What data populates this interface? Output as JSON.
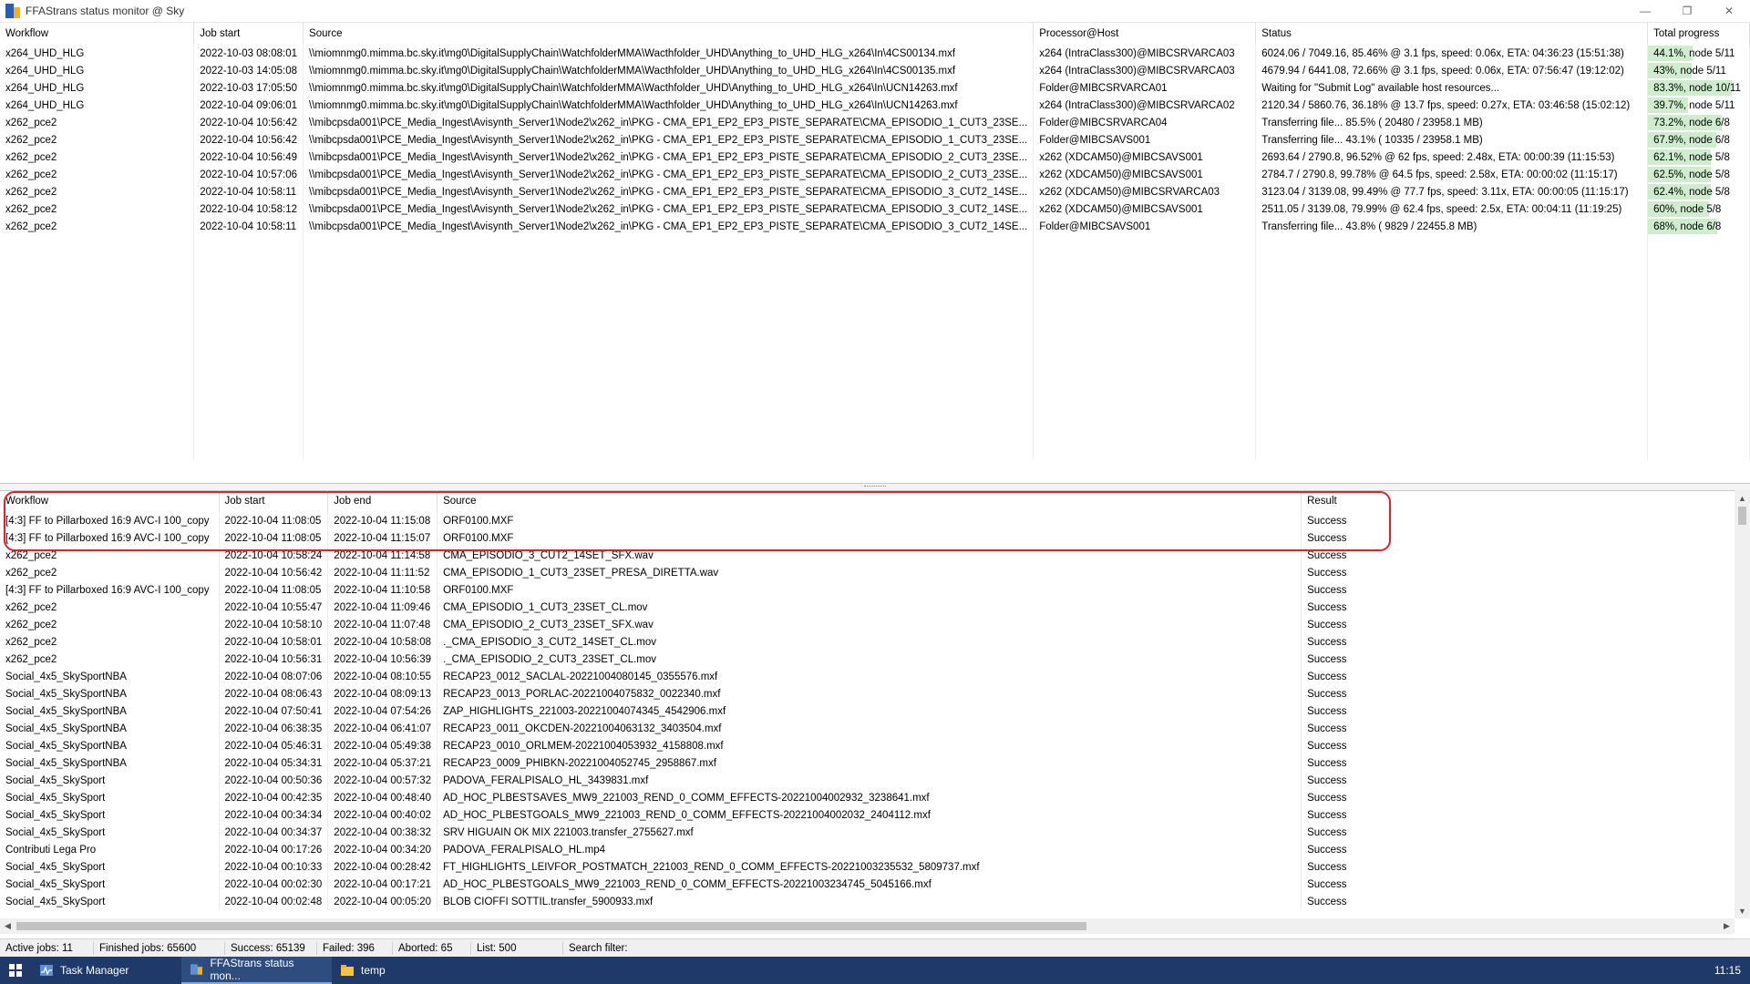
{
  "window": {
    "title": "FFAStrans status monitor @ Sky",
    "minimize": "—",
    "restore": "❐",
    "close": "✕"
  },
  "active_table": {
    "columns": [
      "Workflow",
      "Job start",
      "Source",
      "Processor@Host",
      "Status",
      "Total progress"
    ],
    "rows": [
      [
        "x264_UHD_HLG",
        "2022-10-03 08:08:01",
        "\\\\miomnmg0.mimma.bc.sky.it\\mg0\\DigitalSupplyChain\\WatchfolderMMA\\Wacthfolder_UHD\\Anything_to_UHD_HLG_x264\\In\\4CS00134.mxf",
        "x264 (IntraClass300)@MIBCSRVARCA03",
        "6024.06 / 7049.16, 85.46% @ 3.1 fps, speed: 0.06x, ETA: 04:36:23 (15:51:38)",
        "44.1%, node 5/11",
        44.1
      ],
      [
        "x264_UHD_HLG",
        "2022-10-03 14:05:08",
        "\\\\miomnmg0.mimma.bc.sky.it\\mg0\\DigitalSupplyChain\\WatchfolderMMA\\Wacthfolder_UHD\\Anything_to_UHD_HLG_x264\\In\\4CS00135.mxf",
        "x264 (IntraClass300)@MIBCSRVARCA03",
        "4679.94 / 6441.08, 72.66% @ 3.1 fps, speed: 0.06x, ETA: 07:56:47 (19:12:02)",
        "43%, node 5/11",
        43
      ],
      [
        "x264_UHD_HLG",
        "2022-10-03 17:05:50",
        "\\\\miomnmg0.mimma.bc.sky.it\\mg0\\DigitalSupplyChain\\WatchfolderMMA\\Wacthfolder_UHD\\Anything_to_UHD_HLG_x264\\In\\UCN14263.mxf",
        "Folder@MIBCSRVARCA01",
        "Waiting for \"Submit Log\" available host resources...",
        "83.3%, node 10/11",
        83.3
      ],
      [
        "x264_UHD_HLG",
        "2022-10-04 09:06:01",
        "\\\\miomnmg0.mimma.bc.sky.it\\mg0\\DigitalSupplyChain\\WatchfolderMMA\\Wacthfolder_UHD\\Anything_to_UHD_HLG_x264\\In\\UCN14263.mxf",
        "x264 (IntraClass300)@MIBCSRVARCA02",
        "2120.34 / 5860.76, 36.18% @ 13.7 fps, speed: 0.27x, ETA: 03:46:58 (15:02:12)",
        "39.7%, node 5/11",
        39.7
      ],
      [
        "x262_pce2",
        "2022-10-04 10:56:42",
        "\\\\mibcpsda001\\PCE_Media_Ingest\\Avisynth_Server1\\Node2\\x262_in\\PKG - CMA_EP1_EP2_EP3_PISTE_SEPARATE\\CMA_EPISODIO_1_CUT3_23SE...",
        "Folder@MIBCSRVARCA04",
        "Transferring file... 85.5% ( 20480 / 23958.1 MB)",
        "73.2%, node 6/8",
        73.2
      ],
      [
        "x262_pce2",
        "2022-10-04 10:56:42",
        "\\\\mibcpsda001\\PCE_Media_Ingest\\Avisynth_Server1\\Node2\\x262_in\\PKG - CMA_EP1_EP2_EP3_PISTE_SEPARATE\\CMA_EPISODIO_1_CUT3_23SE...",
        "Folder@MIBCSAVS001",
        "Transferring file... 43.1% ( 10335 / 23958.1 MB)",
        "67.9%, node 6/8",
        67.9
      ],
      [
        "x262_pce2",
        "2022-10-04 10:56:49",
        "\\\\mibcpsda001\\PCE_Media_Ingest\\Avisynth_Server1\\Node2\\x262_in\\PKG - CMA_EP1_EP2_EP3_PISTE_SEPARATE\\CMA_EPISODIO_2_CUT3_23SE...",
        "x262 (XDCAM50)@MIBCSAVS001",
        "2693.64 / 2790.8, 96.52% @ 62 fps, speed: 2.48x, ETA: 00:00:39 (11:15:53)",
        "62.1%, node 5/8",
        62.1
      ],
      [
        "x262_pce2",
        "2022-10-04 10:57:06",
        "\\\\mibcpsda001\\PCE_Media_Ingest\\Avisynth_Server1\\Node2\\x262_in\\PKG - CMA_EP1_EP2_EP3_PISTE_SEPARATE\\CMA_EPISODIO_2_CUT3_23SE...",
        "x262 (XDCAM50)@MIBCSAVS001",
        "2784.7 / 2790.8, 99.78% @ 64.5 fps, speed: 2.58x, ETA: 00:00:02 (11:15:17)",
        "62.5%, node 5/8",
        62.5
      ],
      [
        "x262_pce2",
        "2022-10-04 10:58:11",
        "\\\\mibcpsda001\\PCE_Media_Ingest\\Avisynth_Server1\\Node2\\x262_in\\PKG - CMA_EP1_EP2_EP3_PISTE_SEPARATE\\CMA_EPISODIO_3_CUT2_14SE...",
        "x262 (XDCAM50)@MIBCSRVARCA03",
        "3123.04 / 3139.08, 99.49% @ 77.7 fps, speed: 3.11x, ETA: 00:00:05 (11:15:17)",
        "62.4%, node 5/8",
        62.4
      ],
      [
        "x262_pce2",
        "2022-10-04 10:58:12",
        "\\\\mibcpsda001\\PCE_Media_Ingest\\Avisynth_Server1\\Node2\\x262_in\\PKG - CMA_EP1_EP2_EP3_PISTE_SEPARATE\\CMA_EPISODIO_3_CUT2_14SE...",
        "x262 (XDCAM50)@MIBCSAVS001",
        "2511.05 / 3139.08, 79.99% @ 62.4 fps, speed: 2.5x, ETA: 00:04:11 (11:19:25)",
        "60%, node 5/8",
        60
      ],
      [
        "x262_pce2",
        "2022-10-04 10:58:11",
        "\\\\mibcpsda001\\PCE_Media_Ingest\\Avisynth_Server1\\Node2\\x262_in\\PKG - CMA_EP1_EP2_EP3_PISTE_SEPARATE\\CMA_EPISODIO_3_CUT2_14SE...",
        "Folder@MIBCSAVS001",
        "Transferring file... 43.8% ( 9829 / 22455.8 MB)",
        "68%, node 6/8",
        68
      ]
    ]
  },
  "finished_table": {
    "columns": [
      "Workflow",
      "Job start",
      "Job end",
      "Source",
      "Result"
    ],
    "rows": [
      [
        "[4:3] FF to Pillarboxed 16:9 AVC-I 100_copy",
        "2022-10-04 11:08:05",
        "2022-10-04 11:15:08",
        "ORF0100.MXF",
        "Success"
      ],
      [
        "[4:3] FF to Pillarboxed 16:9 AVC-I 100_copy",
        "2022-10-04 11:08:05",
        "2022-10-04 11:15:07",
        "ORF0100.MXF",
        "Success"
      ],
      [
        "x262_pce2",
        "2022-10-04 10:58:24",
        "2022-10-04 11:14:58",
        "CMA_EPISODIO_3_CUT2_14SET_SFX.wav",
        "Success"
      ],
      [
        "x262_pce2",
        "2022-10-04 10:56:42",
        "2022-10-04 11:11:52",
        "CMA_EPISODIO_1_CUT3_23SET_PRESA_DIRETTA.wav",
        "Success"
      ],
      [
        "[4:3] FF to Pillarboxed 16:9 AVC-I 100_copy",
        "2022-10-04 11:08:05",
        "2022-10-04 11:10:58",
        "ORF0100.MXF",
        "Success"
      ],
      [
        "x262_pce2",
        "2022-10-04 10:55:47",
        "2022-10-04 11:09:46",
        "CMA_EPISODIO_1_CUT3_23SET_CL.mov",
        "Success"
      ],
      [
        "x262_pce2",
        "2022-10-04 10:58:10",
        "2022-10-04 11:07:48",
        "CMA_EPISODIO_2_CUT3_23SET_SFX.wav",
        "Success"
      ],
      [
        "x262_pce2",
        "2022-10-04 10:58:01",
        "2022-10-04 10:58:08",
        "._CMA_EPISODIO_3_CUT2_14SET_CL.mov",
        "Success"
      ],
      [
        "x262_pce2",
        "2022-10-04 10:56:31",
        "2022-10-04 10:56:39",
        "._CMA_EPISODIO_2_CUT3_23SET_CL.mov",
        "Success"
      ],
      [
        "Social_4x5_SkySportNBA",
        "2022-10-04 08:07:06",
        "2022-10-04 08:10:55",
        "RECAP23_0012_SACLAL-20221004080145_0355576.mxf",
        "Success"
      ],
      [
        "Social_4x5_SkySportNBA",
        "2022-10-04 08:06:43",
        "2022-10-04 08:09:13",
        "RECAP23_0013_PORLAC-20221004075832_0022340.mxf",
        "Success"
      ],
      [
        "Social_4x5_SkySportNBA",
        "2022-10-04 07:50:41",
        "2022-10-04 07:54:26",
        "ZAP_HIGHLIGHTS_221003-20221004074345_4542906.mxf",
        "Success"
      ],
      [
        "Social_4x5_SkySportNBA",
        "2022-10-04 06:38:35",
        "2022-10-04 06:41:07",
        "RECAP23_0011_OKCDEN-20221004063132_3403504.mxf",
        "Success"
      ],
      [
        "Social_4x5_SkySportNBA",
        "2022-10-04 05:46:31",
        "2022-10-04 05:49:38",
        "RECAP23_0010_ORLMEM-20221004053932_4158808.mxf",
        "Success"
      ],
      [
        "Social_4x5_SkySportNBA",
        "2022-10-04 05:34:31",
        "2022-10-04 05:37:21",
        "RECAP23_0009_PHIBKN-20221004052745_2958867.mxf",
        "Success"
      ],
      [
        "Social_4x5_SkySport",
        "2022-10-04 00:50:36",
        "2022-10-04 00:57:32",
        "PADOVA_FERALPISALO_HL_3439831.mxf",
        "Success"
      ],
      [
        "Social_4x5_SkySport",
        "2022-10-04 00:42:35",
        "2022-10-04 00:48:40",
        "AD_HOC_PLBESTSAVES_MW9_221003_REND_0_COMM_EFFECTS-20221004002932_3238641.mxf",
        "Success"
      ],
      [
        "Social_4x5_SkySport",
        "2022-10-04 00:34:34",
        "2022-10-04 00:40:02",
        "AD_HOC_PLBESTGOALS_MW9_221003_REND_0_COMM_EFFECTS-20221004002032_2404112.mxf",
        "Success"
      ],
      [
        "Social_4x5_SkySport",
        "2022-10-04 00:34:37",
        "2022-10-04 00:38:32",
        "SRV HIGUAIN OK MIX 221003.transfer_2755627.mxf",
        "Success"
      ],
      [
        "Contributi Lega Pro",
        "2022-10-04 00:17:26",
        "2022-10-04 00:34:20",
        "PADOVA_FERALPISALO_HL.mp4",
        "Success"
      ],
      [
        "Social_4x5_SkySport",
        "2022-10-04 00:10:33",
        "2022-10-04 00:28:42",
        "FT_HIGHLIGHTS_LEIVFOR_POSTMATCH_221003_REND_0_COMM_EFFECTS-20221003235532_5809737.mxf",
        "Success"
      ],
      [
        "Social_4x5_SkySport",
        "2022-10-04 00:02:30",
        "2022-10-04 00:17:21",
        "AD_HOC_PLBESTGOALS_MW9_221003_REND_0_COMM_EFFECTS-20221003234745_5045166.mxf",
        "Success"
      ],
      [
        "Social_4x5_SkySport",
        "2022-10-04 00:02:48",
        "2022-10-04 00:05:20",
        "BLOB CIOFFI SOTTIL.transfer_5900933.mxf",
        "Success"
      ]
    ]
  },
  "statusbar": {
    "active_jobs": "Active jobs: 11",
    "finished_jobs": "Finished jobs: 65600",
    "success": "Success: 65139",
    "failed": "Failed: 396",
    "aborted": "Aborted: 65",
    "list": "List: 500",
    "search_filter": "Search filter:"
  },
  "taskbar": {
    "apps": [
      {
        "label": "Task Manager",
        "icon": "task-manager-icon"
      },
      {
        "label": "FFAStrans status mon...",
        "icon": "ffastrans-icon"
      },
      {
        "label": "temp",
        "icon": "folder-icon"
      }
    ],
    "clock": "11:15"
  },
  "colors": {
    "progress_fill": "#cfeccf",
    "highlight": "#e0202a",
    "taskbar": "#1f3a68"
  }
}
